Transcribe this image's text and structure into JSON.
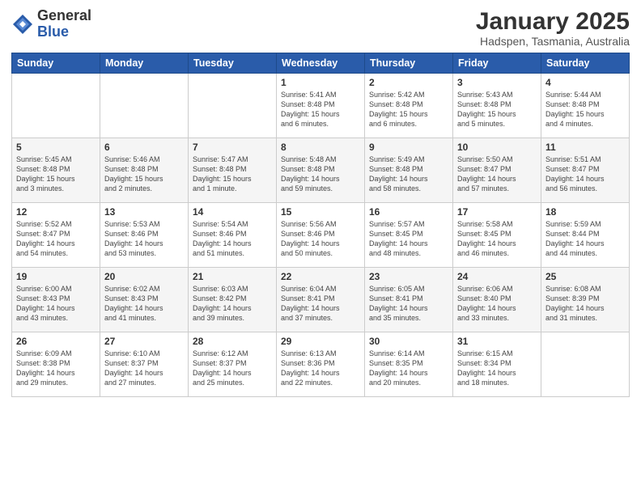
{
  "header": {
    "logo_general": "General",
    "logo_blue": "Blue",
    "month_title": "January 2025",
    "location": "Hadspen, Tasmania, Australia"
  },
  "days_of_week": [
    "Sunday",
    "Monday",
    "Tuesday",
    "Wednesday",
    "Thursday",
    "Friday",
    "Saturday"
  ],
  "weeks": [
    [
      {
        "day": "",
        "detail": ""
      },
      {
        "day": "",
        "detail": ""
      },
      {
        "day": "",
        "detail": ""
      },
      {
        "day": "1",
        "detail": "Sunrise: 5:41 AM\nSunset: 8:48 PM\nDaylight: 15 hours\nand 6 minutes."
      },
      {
        "day": "2",
        "detail": "Sunrise: 5:42 AM\nSunset: 8:48 PM\nDaylight: 15 hours\nand 6 minutes."
      },
      {
        "day": "3",
        "detail": "Sunrise: 5:43 AM\nSunset: 8:48 PM\nDaylight: 15 hours\nand 5 minutes."
      },
      {
        "day": "4",
        "detail": "Sunrise: 5:44 AM\nSunset: 8:48 PM\nDaylight: 15 hours\nand 4 minutes."
      }
    ],
    [
      {
        "day": "5",
        "detail": "Sunrise: 5:45 AM\nSunset: 8:48 PM\nDaylight: 15 hours\nand 3 minutes."
      },
      {
        "day": "6",
        "detail": "Sunrise: 5:46 AM\nSunset: 8:48 PM\nDaylight: 15 hours\nand 2 minutes."
      },
      {
        "day": "7",
        "detail": "Sunrise: 5:47 AM\nSunset: 8:48 PM\nDaylight: 15 hours\nand 1 minute."
      },
      {
        "day": "8",
        "detail": "Sunrise: 5:48 AM\nSunset: 8:48 PM\nDaylight: 14 hours\nand 59 minutes."
      },
      {
        "day": "9",
        "detail": "Sunrise: 5:49 AM\nSunset: 8:48 PM\nDaylight: 14 hours\nand 58 minutes."
      },
      {
        "day": "10",
        "detail": "Sunrise: 5:50 AM\nSunset: 8:47 PM\nDaylight: 14 hours\nand 57 minutes."
      },
      {
        "day": "11",
        "detail": "Sunrise: 5:51 AM\nSunset: 8:47 PM\nDaylight: 14 hours\nand 56 minutes."
      }
    ],
    [
      {
        "day": "12",
        "detail": "Sunrise: 5:52 AM\nSunset: 8:47 PM\nDaylight: 14 hours\nand 54 minutes."
      },
      {
        "day": "13",
        "detail": "Sunrise: 5:53 AM\nSunset: 8:46 PM\nDaylight: 14 hours\nand 53 minutes."
      },
      {
        "day": "14",
        "detail": "Sunrise: 5:54 AM\nSunset: 8:46 PM\nDaylight: 14 hours\nand 51 minutes."
      },
      {
        "day": "15",
        "detail": "Sunrise: 5:56 AM\nSunset: 8:46 PM\nDaylight: 14 hours\nand 50 minutes."
      },
      {
        "day": "16",
        "detail": "Sunrise: 5:57 AM\nSunset: 8:45 PM\nDaylight: 14 hours\nand 48 minutes."
      },
      {
        "day": "17",
        "detail": "Sunrise: 5:58 AM\nSunset: 8:45 PM\nDaylight: 14 hours\nand 46 minutes."
      },
      {
        "day": "18",
        "detail": "Sunrise: 5:59 AM\nSunset: 8:44 PM\nDaylight: 14 hours\nand 44 minutes."
      }
    ],
    [
      {
        "day": "19",
        "detail": "Sunrise: 6:00 AM\nSunset: 8:43 PM\nDaylight: 14 hours\nand 43 minutes."
      },
      {
        "day": "20",
        "detail": "Sunrise: 6:02 AM\nSunset: 8:43 PM\nDaylight: 14 hours\nand 41 minutes."
      },
      {
        "day": "21",
        "detail": "Sunrise: 6:03 AM\nSunset: 8:42 PM\nDaylight: 14 hours\nand 39 minutes."
      },
      {
        "day": "22",
        "detail": "Sunrise: 6:04 AM\nSunset: 8:41 PM\nDaylight: 14 hours\nand 37 minutes."
      },
      {
        "day": "23",
        "detail": "Sunrise: 6:05 AM\nSunset: 8:41 PM\nDaylight: 14 hours\nand 35 minutes."
      },
      {
        "day": "24",
        "detail": "Sunrise: 6:06 AM\nSunset: 8:40 PM\nDaylight: 14 hours\nand 33 minutes."
      },
      {
        "day": "25",
        "detail": "Sunrise: 6:08 AM\nSunset: 8:39 PM\nDaylight: 14 hours\nand 31 minutes."
      }
    ],
    [
      {
        "day": "26",
        "detail": "Sunrise: 6:09 AM\nSunset: 8:38 PM\nDaylight: 14 hours\nand 29 minutes."
      },
      {
        "day": "27",
        "detail": "Sunrise: 6:10 AM\nSunset: 8:37 PM\nDaylight: 14 hours\nand 27 minutes."
      },
      {
        "day": "28",
        "detail": "Sunrise: 6:12 AM\nSunset: 8:37 PM\nDaylight: 14 hours\nand 25 minutes."
      },
      {
        "day": "29",
        "detail": "Sunrise: 6:13 AM\nSunset: 8:36 PM\nDaylight: 14 hours\nand 22 minutes."
      },
      {
        "day": "30",
        "detail": "Sunrise: 6:14 AM\nSunset: 8:35 PM\nDaylight: 14 hours\nand 20 minutes."
      },
      {
        "day": "31",
        "detail": "Sunrise: 6:15 AM\nSunset: 8:34 PM\nDaylight: 14 hours\nand 18 minutes."
      },
      {
        "day": "",
        "detail": ""
      }
    ]
  ]
}
